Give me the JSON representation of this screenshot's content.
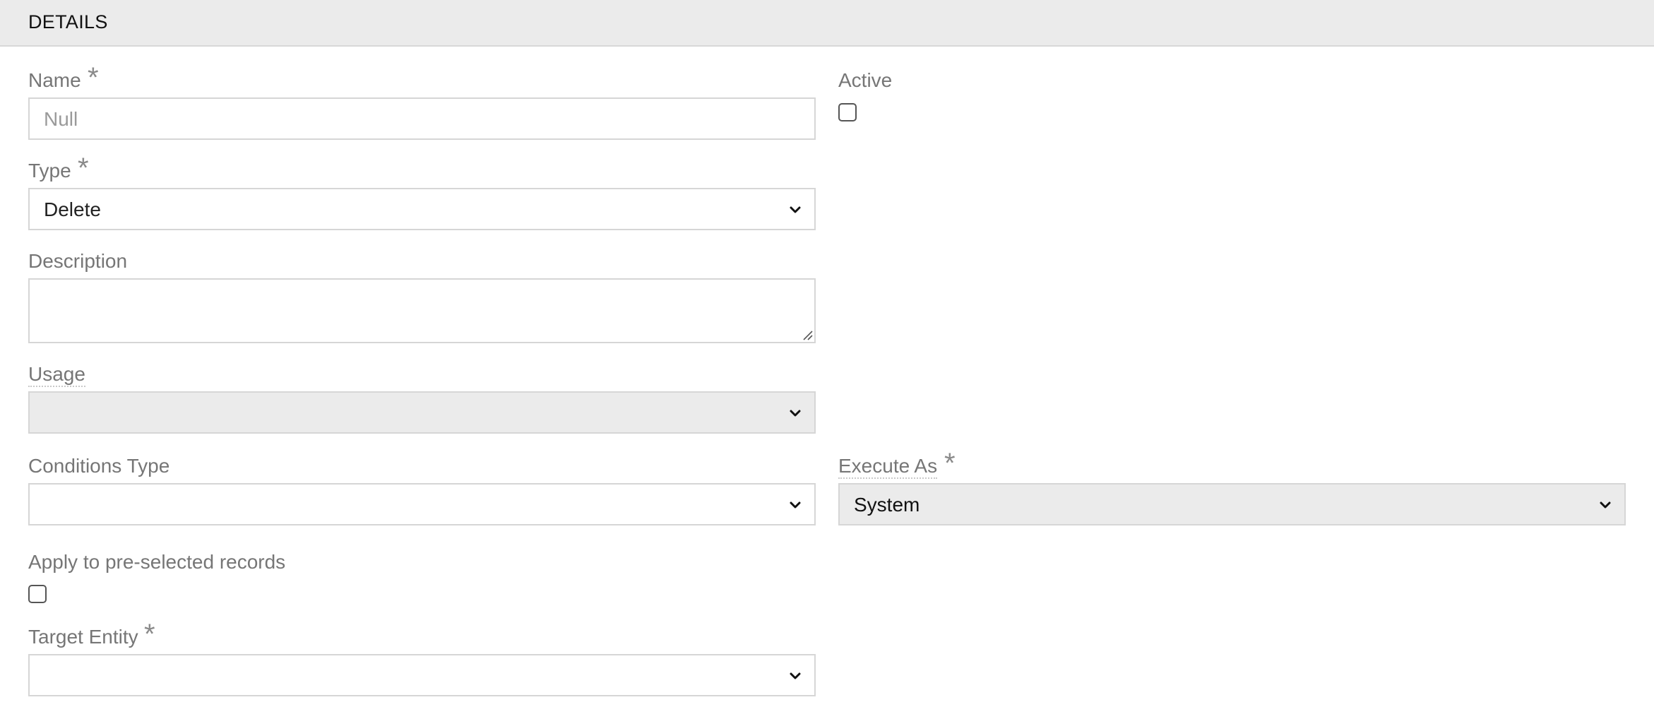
{
  "header": {
    "title": "DETAILS"
  },
  "fields": {
    "name": {
      "label": "Name",
      "required_mark": "*",
      "placeholder": "Null",
      "value": ""
    },
    "active": {
      "label": "Active",
      "checked": false
    },
    "type": {
      "label": "Type",
      "required_mark": "*",
      "value": "Delete"
    },
    "description": {
      "label": "Description",
      "value": ""
    },
    "usage": {
      "label": "Usage",
      "value": ""
    },
    "conditions_type": {
      "label": "Conditions Type",
      "value": ""
    },
    "execute_as": {
      "label": "Execute As",
      "required_mark": "*",
      "value": "System"
    },
    "apply_preselected": {
      "label": "Apply to pre-selected records",
      "checked": false
    },
    "target_entity": {
      "label": "Target Entity",
      "required_mark": "*",
      "value": ""
    }
  },
  "icons": {
    "chevron": "chevron-down-icon",
    "resize": "resize-grip-icon"
  },
  "colors": {
    "header_bg": "#ebebeb",
    "label": "#767676",
    "border": "#d6d6d6",
    "disabled_bg": "#ebebeb"
  }
}
